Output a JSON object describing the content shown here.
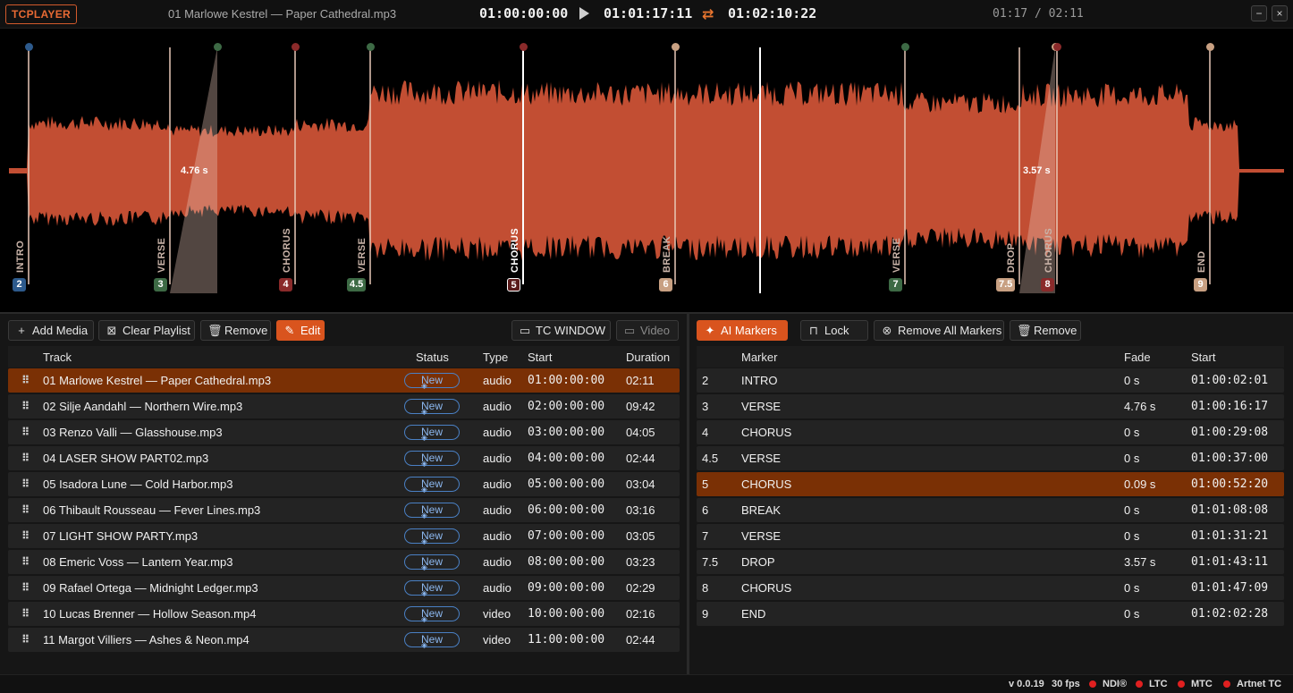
{
  "app": {
    "brand": "TCPLAYER",
    "file_title": "01 Marlowe Kestrel — Paper Cathedral.mp3",
    "tc_in": "01:00:00:00",
    "tc_current": "01:01:17:11",
    "tc_out": "01:02:10:22",
    "counter": "01:17 / 02:11",
    "min_label": "−",
    "close_label": "×"
  },
  "colors": {
    "accent": "#d9541e",
    "waveform": "#c24e33",
    "selected_row": "#7a3005",
    "status_pill": "#4a80c4"
  },
  "waveform": {
    "progress": 0.5876,
    "fades": [
      {
        "label": "4.76 s"
      },
      {
        "label": "3.57 s"
      }
    ],
    "markers": [
      {
        "badge": "2",
        "name": "INTRO",
        "color": "#2d5a8c"
      },
      {
        "badge": "3",
        "name": "VERSE",
        "color": "#3d6a45"
      },
      {
        "badge": "4",
        "name": "CHORUS",
        "color": "#8a2a2a"
      },
      {
        "badge": "4.5",
        "name": "VERSE",
        "color": "#3d6a45"
      },
      {
        "badge": "5",
        "name": "CHORUS",
        "color": "#8a2a2a"
      },
      {
        "badge": "6",
        "name": "BREAK",
        "color": "#c8a082"
      },
      {
        "badge": "7",
        "name": "VERSE",
        "color": "#3d6a45"
      },
      {
        "badge": "7.5",
        "name": "DROP",
        "color": "#c8a082"
      },
      {
        "badge": "8",
        "name": "CHORUS",
        "color": "#8a2a2a"
      },
      {
        "badge": "9",
        "name": "END",
        "color": "#c8a082"
      }
    ]
  },
  "left_toolbar": {
    "add_media": "Add Media",
    "clear_playlist": "Clear Playlist",
    "remove": "Remove",
    "edit": "Edit",
    "tc_window": "TC WINDOW",
    "video": "Video"
  },
  "playlist": {
    "headers": {
      "track": "Track",
      "status": "Status",
      "type": "Type",
      "start": "Start",
      "duration": "Duration"
    },
    "rows": [
      {
        "track": "01 Marlowe Kestrel — Paper Cathedral.mp3",
        "status": "New",
        "type": "audio",
        "start": "01:00:00:00",
        "duration": "02:11"
      },
      {
        "track": "02 Silje Aandahl — Northern Wire.mp3",
        "status": "New",
        "type": "audio",
        "start": "02:00:00:00",
        "duration": "09:42"
      },
      {
        "track": "03 Renzo Valli — Glasshouse.mp3",
        "status": "New",
        "type": "audio",
        "start": "03:00:00:00",
        "duration": "04:05"
      },
      {
        "track": "04 LASER SHOW PART02.mp3",
        "status": "New",
        "type": "audio",
        "start": "04:00:00:00",
        "duration": "02:44"
      },
      {
        "track": "05 Isadora Lune — Cold Harbor.mp3",
        "status": "New",
        "type": "audio",
        "start": "05:00:00:00",
        "duration": "03:04"
      },
      {
        "track": "06 Thibault Rousseau — Fever Lines.mp3",
        "status": "New",
        "type": "audio",
        "start": "06:00:00:00",
        "duration": "03:16"
      },
      {
        "track": "07 LIGHT SHOW PARTY.mp3",
        "status": "New",
        "type": "audio",
        "start": "07:00:00:00",
        "duration": "03:05"
      },
      {
        "track": "08 Emeric Voss — Lantern Year.mp3",
        "status": "New",
        "type": "audio",
        "start": "08:00:00:00",
        "duration": "03:23"
      },
      {
        "track": "09 Rafael Ortega — Midnight Ledger.mp3",
        "status": "New",
        "type": "audio",
        "start": "09:00:00:00",
        "duration": "02:29"
      },
      {
        "track": "10 Lucas Brenner — Hollow Season.mp4",
        "status": "New",
        "type": "video",
        "start": "10:00:00:00",
        "duration": "02:16"
      },
      {
        "track": "11 Margot Villiers — Ashes & Neon.mp4",
        "status": "New",
        "type": "video",
        "start": "11:00:00:00",
        "duration": "02:44"
      }
    ]
  },
  "right_toolbar": {
    "ai_markers": "AI Markers",
    "lock": "Lock",
    "remove_all": "Remove All Markers",
    "remove": "Remove"
  },
  "markers_table": {
    "headers": {
      "marker": "Marker",
      "fade": "Fade",
      "start": "Start"
    },
    "rows": [
      {
        "id": "2",
        "name": "INTRO",
        "fade": "0 s",
        "start": "01:00:02:01"
      },
      {
        "id": "3",
        "name": "VERSE",
        "fade": "4.76 s",
        "start": "01:00:16:17"
      },
      {
        "id": "4",
        "name": "CHORUS",
        "fade": "0 s",
        "start": "01:00:29:08"
      },
      {
        "id": "4.5",
        "name": "VERSE",
        "fade": "0 s",
        "start": "01:00:37:00"
      },
      {
        "id": "5",
        "name": "CHORUS",
        "fade": "0.09 s",
        "start": "01:00:52:20"
      },
      {
        "id": "6",
        "name": "BREAK",
        "fade": "0 s",
        "start": "01:01:08:08"
      },
      {
        "id": "7",
        "name": "VERSE",
        "fade": "0 s",
        "start": "01:01:31:21"
      },
      {
        "id": "7.5",
        "name": "DROP",
        "fade": "3.57 s",
        "start": "01:01:43:11"
      },
      {
        "id": "8",
        "name": "CHORUS",
        "fade": "0 s",
        "start": "01:01:47:09"
      },
      {
        "id": "9",
        "name": "END",
        "fade": "0 s",
        "start": "01:02:02:28"
      }
    ]
  },
  "statusbar": {
    "version": "v 0.0.19",
    "fps": "30 fps",
    "ndi": "NDI®",
    "ltc": "LTC",
    "mtc": "MTC",
    "artnet": "Artnet TC"
  }
}
